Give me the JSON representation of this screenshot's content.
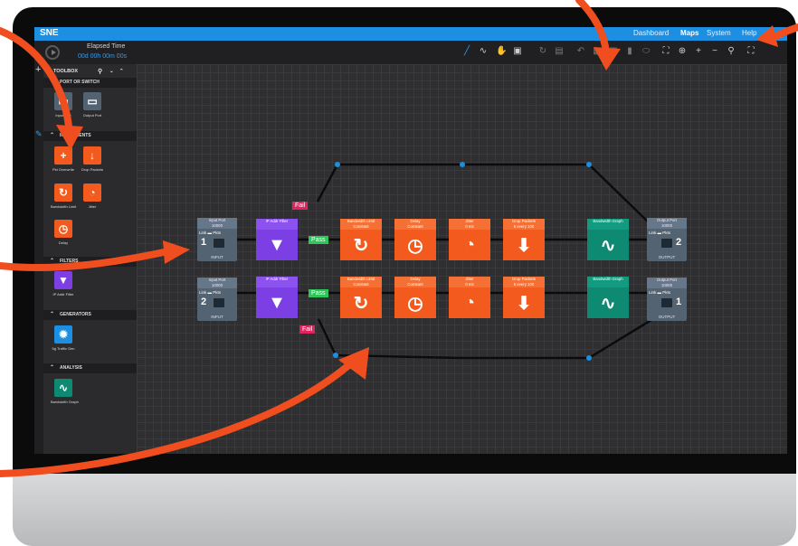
{
  "app": {
    "title": "SNE"
  },
  "nav": {
    "items": [
      "Dashboard",
      "Maps",
      "System",
      "Help"
    ],
    "active": "Maps"
  },
  "timer": {
    "label": "Elapsed Time",
    "value": "00d 00h 00m 00s"
  },
  "toolbar": {
    "icons": [
      "pen-icon",
      "line-icon",
      "hand-icon",
      "select-icon",
      "redo-icon",
      "save-icon",
      "undo-icon",
      "copy-icon",
      "paste-icon",
      "delete-icon",
      "toggle-icon",
      "fit-icon",
      "target-icon",
      "zoom-in-icon",
      "zoom-out-icon",
      "search-icon",
      "fullscreen-icon"
    ]
  },
  "toolbox": {
    "title": "TOOLBOX",
    "sections": {
      "port": "PORT OR SWITCH",
      "impairments": "IMPAIRMENTS",
      "filters": "FILTERS",
      "generators": "GENERATORS",
      "analysis": "ANALYSIS"
    },
    "items": {
      "input_port": "Input Port",
      "output_port": "Output Port",
      "pkt_overwrite": "Pkt Overwrite",
      "drop_packets": "Drop Packets",
      "bandwidth_limit": "Bandwidth Limit",
      "jitter": "Jitter",
      "delay": "Delay",
      "ip_filter": "IP Addr Filter",
      "traffic_gen": "5g Traffic Gen",
      "bw_graph": "Bandwidth Graph"
    }
  },
  "flow1": {
    "in": {
      "title": "Input Port",
      "rate": "10000",
      "num": "1",
      "sub": "INPUT"
    },
    "filter": {
      "title": "IP Addr Filter"
    },
    "bw": {
      "title": "Bandwidth Limit",
      "sub": "Constant"
    },
    "delay": {
      "title": "Delay",
      "sub": "Constant"
    },
    "jitter": {
      "title": "Jitter",
      "sub": "0 ms"
    },
    "drop": {
      "title": "Drop Packets",
      "sub": "5 every 100"
    },
    "graph": {
      "title": "Bandwidth Graph"
    },
    "out": {
      "title": "Output Port",
      "rate": "10000",
      "num": "2",
      "sub": "OUTPUT"
    }
  },
  "flow2": {
    "in": {
      "title": "Input Port",
      "rate": "10000",
      "num": "2",
      "sub": "INPUT"
    },
    "filter": {
      "title": "IP Addr Filter"
    },
    "bw": {
      "title": "Bandwidth Limit",
      "sub": "Constant"
    },
    "delay": {
      "title": "Delay",
      "sub": "Constant"
    },
    "jitter": {
      "title": "Jitter",
      "sub": "0 ms"
    },
    "drop": {
      "title": "Drop Packets",
      "sub": "5 every 100"
    },
    "graph": {
      "title": "Bandwidth Graph"
    },
    "out": {
      "title": "Output Port",
      "rate": "10000",
      "num": "1",
      "sub": "OUTPUT"
    }
  },
  "labels": {
    "link": "Link",
    "pkts": "Pkts",
    "pass": "Pass",
    "fail": "Fail"
  },
  "colors": {
    "accent": "#1d8fe3",
    "impairment": "#f25a1e",
    "filter": "#7b3fe4",
    "graph": "#0f8a72",
    "port": "#546372",
    "pass": "#2ec55a",
    "fail": "#e0245e",
    "annotation": "#f04e1f"
  }
}
